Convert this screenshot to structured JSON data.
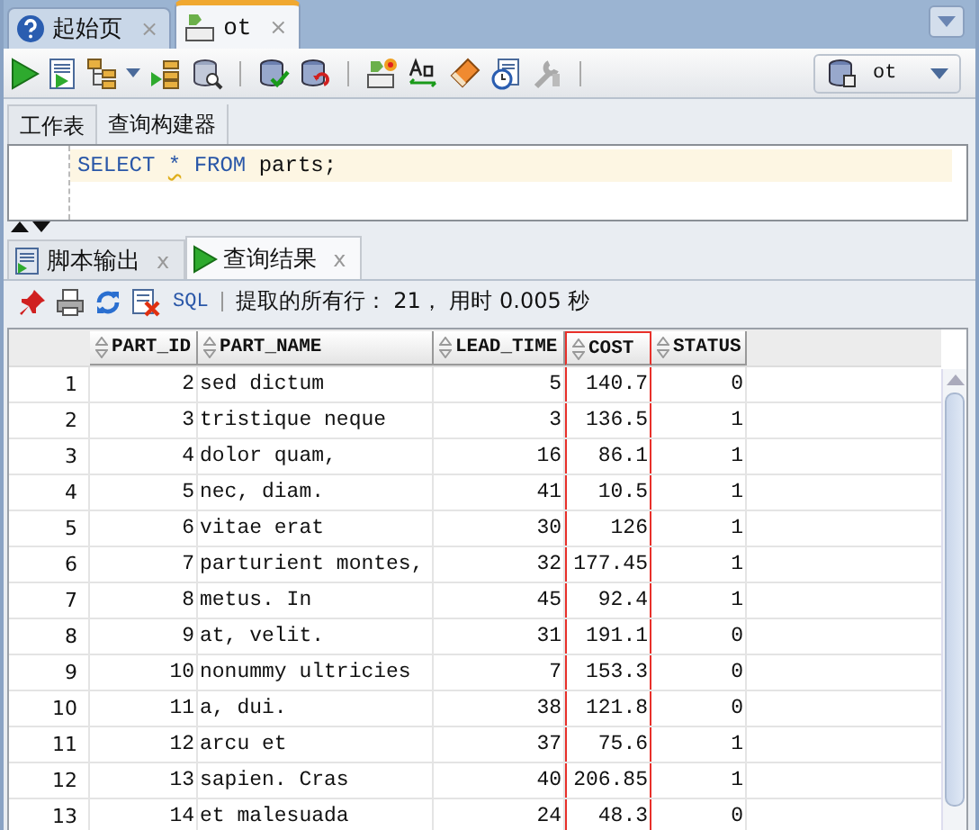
{
  "editor_tabs": [
    {
      "label": "起始页",
      "selected": false,
      "close": "×"
    },
    {
      "label": "ot",
      "selected": true,
      "close": "×"
    }
  ],
  "connection": {
    "value": "ot"
  },
  "worksheet_tabs": [
    {
      "label": "工作表",
      "selected": true
    },
    {
      "label": "查询构建器",
      "selected": false
    }
  ],
  "editor": {
    "tokens": [
      {
        "text": "SELECT",
        "kind": "keyword"
      },
      {
        "text": "*",
        "kind": "warning"
      },
      {
        "text": "FROM",
        "kind": "keyword"
      },
      {
        "text": "parts;",
        "kind": "plain"
      }
    ]
  },
  "result_tabs": [
    {
      "label": "脚本输出",
      "selected": false,
      "close": "x"
    },
    {
      "label": "查询结果",
      "selected": true,
      "close": "x"
    }
  ],
  "result_toolbar": {
    "sql_label": "SQL",
    "status": "提取的所有行： 21， 用时 0.005 秒"
  },
  "grid": {
    "columns": [
      {
        "label": "PART_ID",
        "kind": "number",
        "highlighted": false
      },
      {
        "label": "PART_NAME",
        "kind": "text",
        "highlighted": false
      },
      {
        "label": "LEAD_TIME",
        "kind": "number",
        "highlighted": false
      },
      {
        "label": "COST",
        "kind": "number",
        "highlighted": true
      },
      {
        "label": "STATUS",
        "kind": "number",
        "highlighted": false
      }
    ],
    "rows": [
      {
        "row_number": "1",
        "cells": [
          "2",
          "sed dictum",
          "5",
          "140.7",
          "0"
        ]
      },
      {
        "row_number": "2",
        "cells": [
          "3",
          "tristique neque",
          "3",
          "136.5",
          "1"
        ]
      },
      {
        "row_number": "3",
        "cells": [
          "4",
          "dolor quam,",
          "16",
          "86.1",
          "1"
        ]
      },
      {
        "row_number": "4",
        "cells": [
          "5",
          "nec, diam.",
          "41",
          "10.5",
          "1"
        ]
      },
      {
        "row_number": "5",
        "cells": [
          "6",
          "vitae erat",
          "30",
          "126",
          "1"
        ]
      },
      {
        "row_number": "6",
        "cells": [
          "7",
          "parturient montes,",
          "32",
          "177.45",
          "1"
        ]
      },
      {
        "row_number": "7",
        "cells": [
          "8",
          "metus. In",
          "45",
          "92.4",
          "1"
        ]
      },
      {
        "row_number": "8",
        "cells": [
          "9",
          "at, velit.",
          "31",
          "191.1",
          "0"
        ]
      },
      {
        "row_number": "9",
        "cells": [
          "10",
          "nonummy ultricies",
          "7",
          "153.3",
          "0"
        ]
      },
      {
        "row_number": "10",
        "cells": [
          "11",
          "a, dui.",
          "38",
          "121.8",
          "0"
        ]
      },
      {
        "row_number": "11",
        "cells": [
          "12",
          "arcu et",
          "37",
          "75.6",
          "1"
        ]
      },
      {
        "row_number": "12",
        "cells": [
          "13",
          "sapien. Cras",
          "40",
          "206.85",
          "1"
        ]
      },
      {
        "row_number": "13",
        "cells": [
          "14",
          "et malesuada",
          "24",
          "48.3",
          "0"
        ]
      }
    ]
  }
}
